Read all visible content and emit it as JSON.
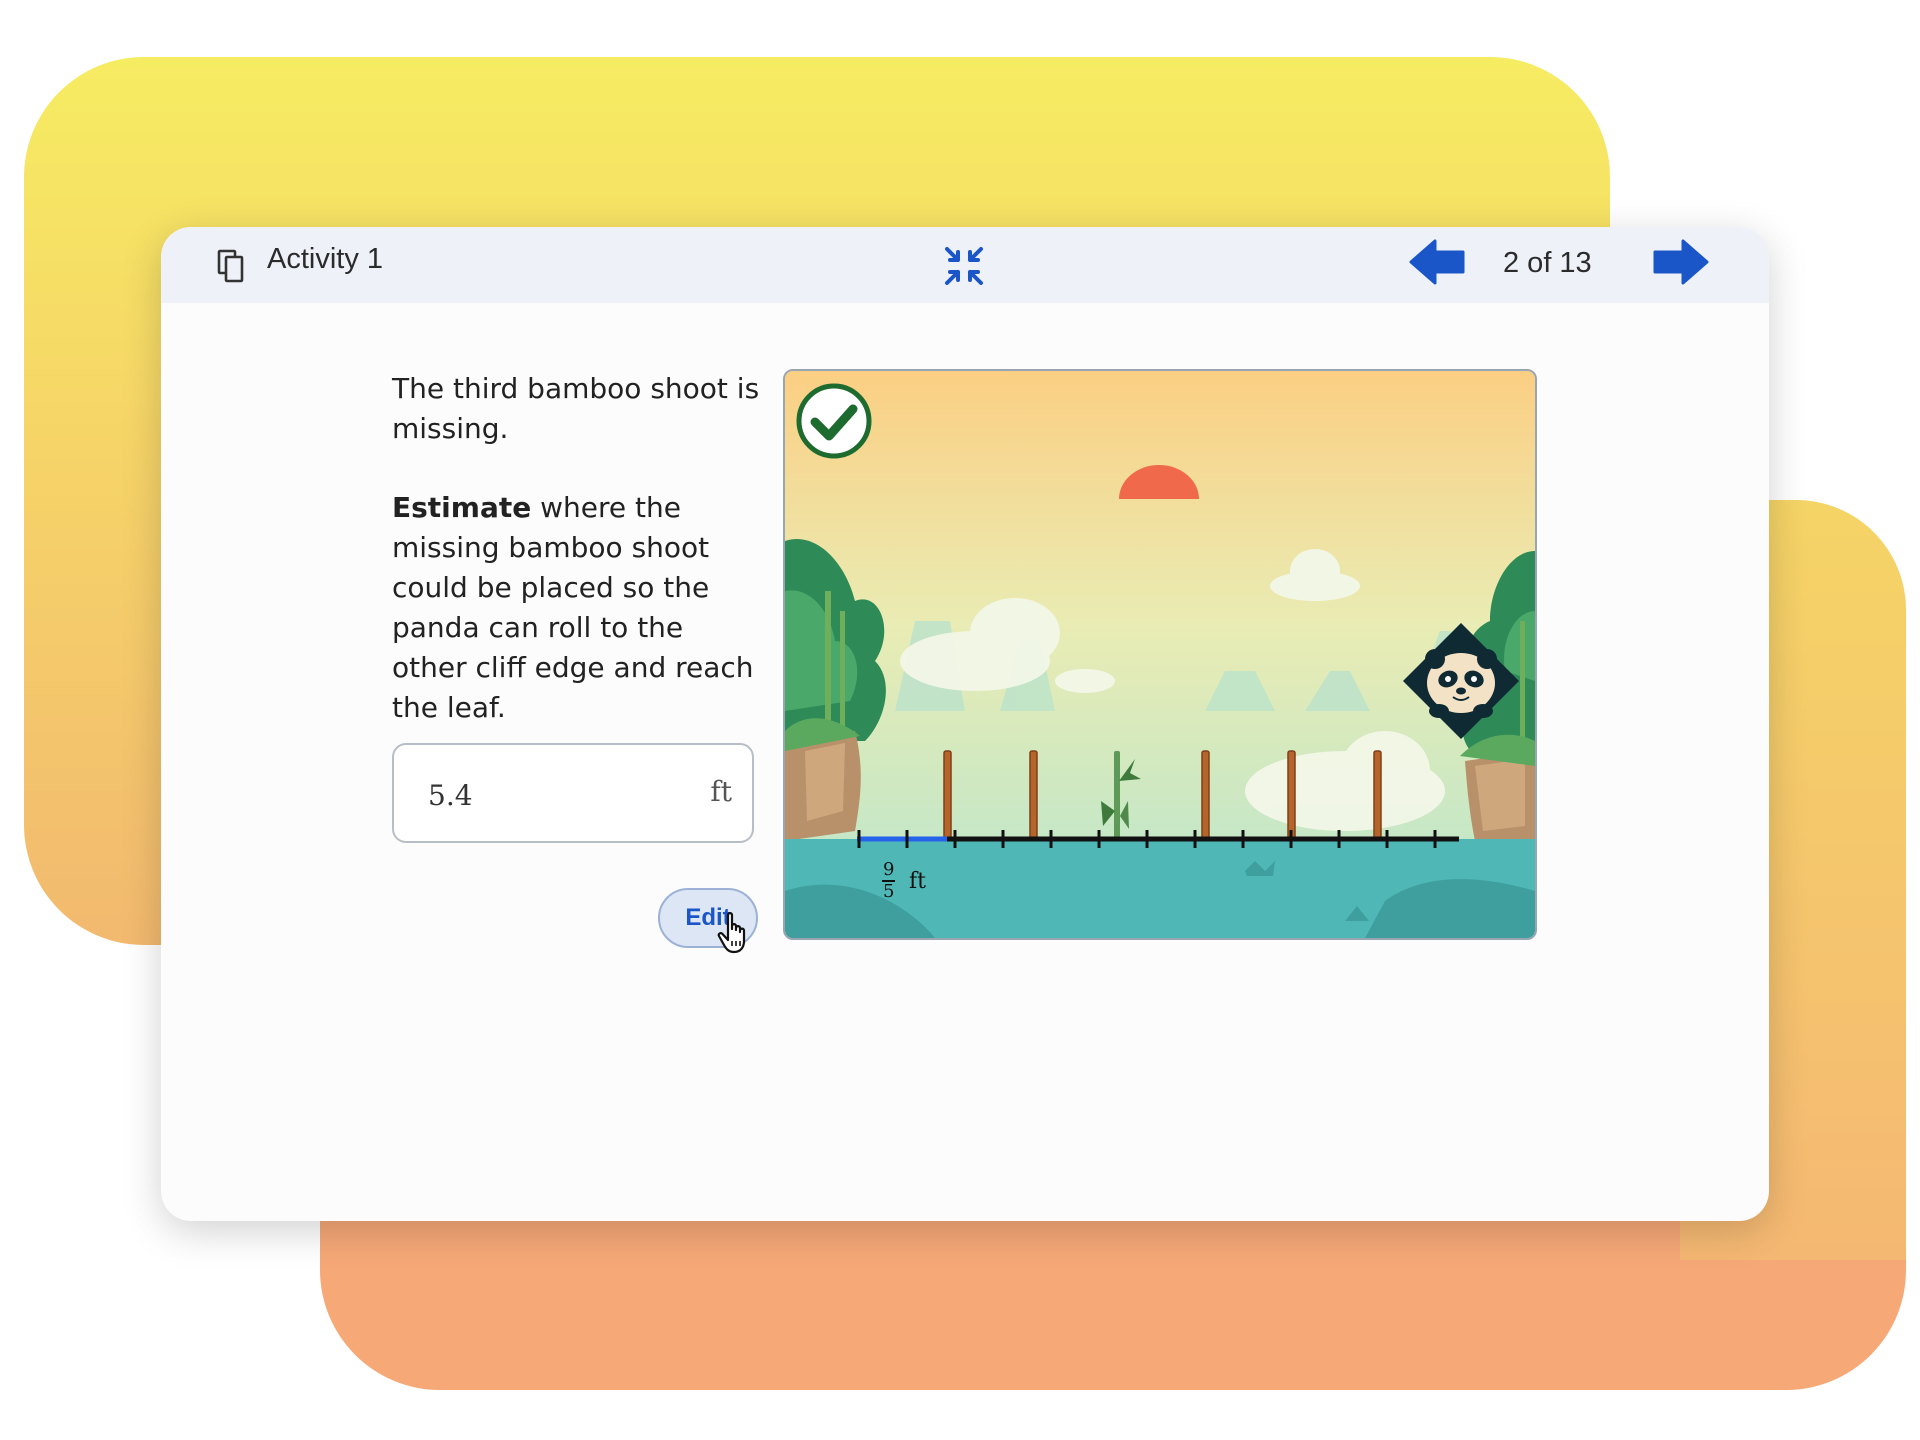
{
  "window": {
    "title": "Activity 1",
    "page_counter": "2 of 13"
  },
  "question": {
    "line1": "The third bamboo shoot is missing.",
    "bold_word": "Estimate",
    "rest": " where the missing bamboo shoot could be placed so the panda can roll to the other cliff edge and reach the leaf."
  },
  "answer": {
    "value": "5.4",
    "unit": "ft"
  },
  "edit_button": {
    "label": "Edit"
  },
  "number_line": {
    "tick_label_numerator": "9",
    "tick_label_denominator": "5",
    "tick_label_unit": "ft",
    "status": "correct"
  },
  "colors": {
    "accent_blue": "#1b56c9",
    "check_green": "#1e6b2f",
    "sun": "#f0694a",
    "water": "#4fb8b7"
  },
  "icons": {
    "copy": "copy-icon",
    "collapse": "collapse-icon",
    "prev": "arrow-left-icon",
    "next": "arrow-right-icon",
    "check": "check-circle-icon",
    "cursor": "hand-pointer-icon"
  }
}
